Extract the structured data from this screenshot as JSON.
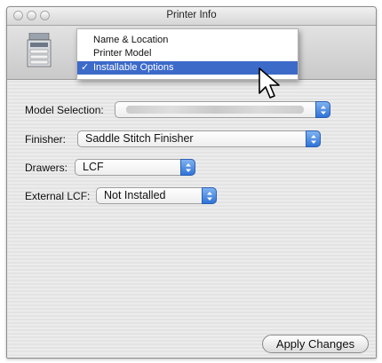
{
  "window": {
    "title": "Printer Info"
  },
  "menu": {
    "items": [
      {
        "label": "Name & Location",
        "selected": false
      },
      {
        "label": "Printer Model",
        "selected": false
      },
      {
        "label": "Installable Options",
        "selected": true
      }
    ],
    "check_glyph": "✓"
  },
  "form": {
    "model_selection": {
      "label": "Model Selection:",
      "value": ""
    },
    "finisher": {
      "label": "Finisher:",
      "value": "Saddle Stitch Finisher"
    },
    "drawers": {
      "label": "Drawers:",
      "value": "LCF"
    },
    "external_lcf": {
      "label": "External LCF:",
      "value": "Not Installed"
    }
  },
  "buttons": {
    "apply": "Apply Changes"
  },
  "colors": {
    "menu_highlight": "#3c6ac9",
    "popup_arrow": "#2f73d8"
  }
}
